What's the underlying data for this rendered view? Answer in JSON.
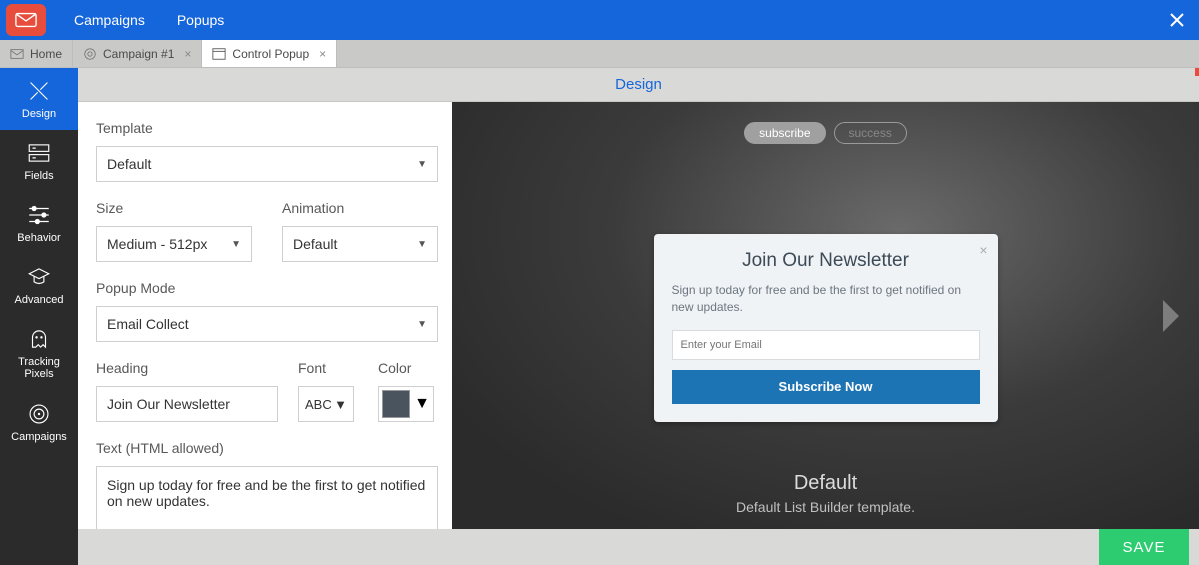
{
  "topnav": {
    "items": [
      "Campaigns",
      "Popups"
    ]
  },
  "tabs": [
    {
      "label": "Home",
      "icon": "home"
    },
    {
      "label": "Campaign #1",
      "icon": "target",
      "closable": true
    },
    {
      "label": "Control Popup",
      "icon": "window",
      "closable": true,
      "active": true
    }
  ],
  "midheader": {
    "title": "Design"
  },
  "leftnav": [
    {
      "label": "Design",
      "active": true
    },
    {
      "label": "Fields"
    },
    {
      "label": "Behavior"
    },
    {
      "label": "Advanced"
    },
    {
      "label": "Tracking Pixels"
    },
    {
      "label": "Campaigns"
    }
  ],
  "form": {
    "template_label": "Template",
    "template_value": "Default",
    "size_label": "Size",
    "size_value": "Medium - 512px",
    "animation_label": "Animation",
    "animation_value": "Default",
    "mode_label": "Popup Mode",
    "mode_value": "Email Collect",
    "heading_label": "Heading",
    "heading_value": "Join Our Newsletter",
    "font_label": "Font",
    "font_value": "ABC",
    "color_label": "Color",
    "color_value": "#4a545e",
    "text_label": "Text (HTML allowed)",
    "text_value": "Sign up today for free and be the first to get notified on new updates."
  },
  "preview": {
    "pills": [
      "subscribe",
      "success"
    ],
    "popup": {
      "title": "Join Our Newsletter",
      "subtitle": "Sign up today for free and be the first to get notified on new updates.",
      "placeholder": "Enter your Email",
      "button": "Subscribe Now"
    },
    "footer_title": "Default",
    "footer_sub": "Default List Builder template."
  },
  "bottombar": {
    "save": "SAVE"
  }
}
